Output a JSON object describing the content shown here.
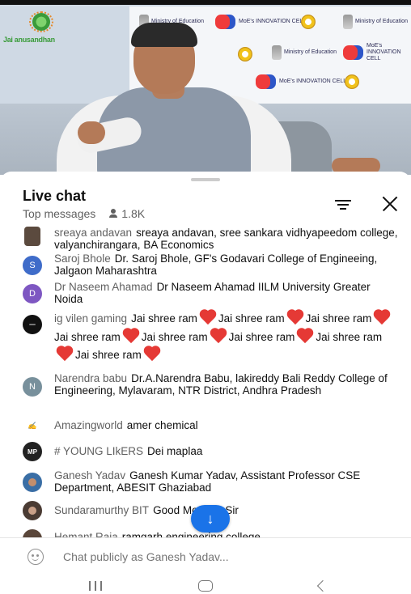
{
  "video": {
    "channel_logo_text": "Jai anusandhan",
    "backdrop_logos": [
      {
        "kind": "emblem",
        "text": "Ministry of Education"
      },
      {
        "kind": "brain",
        "text": "MoE's INNOVATION CELL"
      },
      {
        "kind": "yellow",
        "text": "AICTE"
      }
    ]
  },
  "chat": {
    "title": "Live chat",
    "mode": "Top messages",
    "viewers": "1.8K",
    "messages": [
      {
        "author": "sreaya andavan",
        "text": "sreaya andavan, sree sankara vidhyapeedom college, valyanchirangara, BA Economics",
        "avatar_letter": "",
        "avatar_color": "#5b4a3e"
      },
      {
        "author": "Saroj Bhole",
        "text": "Dr. Saroj Bhole, GF's Godavari College of Engineeing, Jalgaon Maharashtra",
        "avatar_letter": "S",
        "avatar_color": "#3f6cc9"
      },
      {
        "author": "Dr Naseem Ahamad",
        "text": "Dr Naseem Ahamad IILM University Greater Noida",
        "avatar_letter": "D",
        "avatar_color": "#7e57c2"
      },
      {
        "author": "ig vilen gaming",
        "text_parts": [
          "Jai shree ram",
          "Jai shree ram",
          "Jai shree ram",
          "Jai shree ram",
          "Jai shree ram",
          "Jai shree ram",
          "Jai shree ram",
          "Jai shree ram"
        ],
        "avatar_letter": "",
        "avatar_color": "#111111"
      },
      {
        "author": "Narendra babu",
        "text": "Dr.A.Narendra Babu, lakireddy Bali Reddy College of Engineering, Mylavaram, NTR District, Andhra Pradesh",
        "avatar_letter": "N",
        "avatar_color": "#78909c"
      },
      {
        "author": "Amazingworld",
        "text": "amer chemical",
        "avatar_letter": "",
        "avatar_color": "#ffffff"
      },
      {
        "author": "# YOUNG LIkERS",
        "text": "Dei maplaa",
        "avatar_letter": "MP",
        "avatar_color": "#222222"
      },
      {
        "author": "Ganesh Yadav",
        "text": "Ganesh Kumar Yadav, Assistant Professor CSE Department, ABESIT Ghaziabad",
        "avatar_letter": "",
        "avatar_color": "#3a6ea5"
      },
      {
        "author": "Sundaramurthy BIT",
        "text": "Good Morning Sir",
        "avatar_letter": "",
        "avatar_color": "#4a3b33"
      },
      {
        "author": "Hemant Raja",
        "text": "ramgarh engineering college",
        "avatar_letter": "",
        "avatar_color": "#5a463a"
      }
    ],
    "input_placeholder": "Chat publicly as Ganesh Yadav...",
    "scroll_down_symbol": "↓"
  },
  "icons": {
    "filter": "filter-icon",
    "close": "close-icon",
    "emoji": "emoji-icon",
    "heart": "heart-icon",
    "person": "person-icon"
  },
  "colors": {
    "accent": "#1a73e8",
    "heart": "#e53935",
    "secondary_text": "#606060"
  }
}
